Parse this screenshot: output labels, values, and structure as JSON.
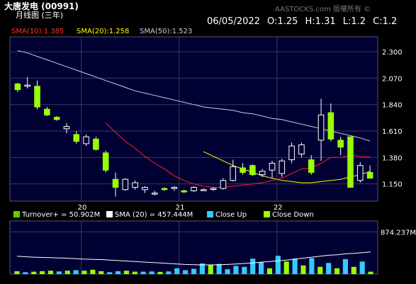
{
  "header": {
    "title": "大唐发电 (00991)",
    "subtitle": "月线图 (三年)",
    "watermark": "AASTOCKS.com 版權所有 ©",
    "ohlc": "06/05/2022  O:1.25  H:1.31  L:1.2  C:1.2"
  },
  "colors": {
    "background": "#000000",
    "plot_bg": "#000033",
    "grid": "#3a3a66",
    "candle": "#99ff00",
    "candle_outline": "#ffffff",
    "sma10": "#ff2020",
    "sma20": "#ffff00",
    "sma50": "#ccccdd",
    "turnover": "#66cc00",
    "turnover_sma": "#ffffff",
    "close_up": "#33ccff",
    "close_down": "#99ff00"
  },
  "sma_legend": {
    "sma10": "SMA(10):1.385",
    "sma20": "SMA(20):1.258",
    "sma50": "SMA(50):1.523"
  },
  "volume_legend": {
    "turnover": "Turnover+ = 50.902M",
    "sma": "SMA (20) = 457.444M",
    "close_up": "Close Up",
    "close_down": "Close Down",
    "axis_label": "874.237M"
  },
  "chart_data": [
    {
      "type": "candlestick",
      "y_ticks": [
        "2.300",
        "2.070",
        "1.840",
        "1.610",
        "1.380",
        "1.150"
      ],
      "ylim": [
        1.0,
        2.43
      ],
      "x_ticks": [
        "20",
        "21",
        "22"
      ],
      "x_tick_index": [
        6.5,
        16.5,
        26.5
      ],
      "candles": [
        {
          "o": 2.02,
          "h": 2.03,
          "l": 1.95,
          "c": 1.97
        },
        {
          "o": 2.0,
          "h": 2.08,
          "l": 1.98,
          "c": 2.01
        },
        {
          "o": 2.0,
          "h": 2.05,
          "l": 1.8,
          "c": 1.82
        },
        {
          "o": 1.8,
          "h": 1.82,
          "l": 1.74,
          "c": 1.75
        },
        {
          "o": 1.73,
          "h": 1.74,
          "l": 1.7,
          "c": 1.71
        },
        {
          "o": 1.63,
          "h": 1.68,
          "l": 1.59,
          "c": 1.65
        },
        {
          "o": 1.58,
          "h": 1.61,
          "l": 1.5,
          "c": 1.52
        },
        {
          "o": 1.5,
          "h": 1.58,
          "l": 1.48,
          "c": 1.56
        },
        {
          "o": 1.54,
          "h": 1.56,
          "l": 1.44,
          "c": 1.45
        },
        {
          "o": 1.42,
          "h": 1.44,
          "l": 1.25,
          "c": 1.27
        },
        {
          "o": 1.19,
          "h": 1.25,
          "l": 1.04,
          "c": 1.12
        },
        {
          "o": 1.1,
          "h": 1.2,
          "l": 1.09,
          "c": 1.19
        },
        {
          "o": 1.12,
          "h": 1.18,
          "l": 1.1,
          "c": 1.16
        },
        {
          "o": 1.1,
          "h": 1.13,
          "l": 1.07,
          "c": 1.12
        },
        {
          "o": 1.07,
          "h": 1.09,
          "l": 1.05,
          "c": 1.07
        },
        {
          "o": 1.11,
          "h": 1.12,
          "l": 1.09,
          "c": 1.1
        },
        {
          "o": 1.11,
          "h": 1.13,
          "l": 1.09,
          "c": 1.12
        },
        {
          "o": 1.09,
          "h": 1.1,
          "l": 1.07,
          "c": 1.08
        },
        {
          "o": 1.09,
          "h": 1.13,
          "l": 1.08,
          "c": 1.12
        },
        {
          "o": 1.1,
          "h": 1.11,
          "l": 1.09,
          "c": 1.1
        },
        {
          "o": 1.11,
          "h": 1.12,
          "l": 1.09,
          "c": 1.11
        },
        {
          "o": 1.11,
          "h": 1.2,
          "l": 1.1,
          "c": 1.18
        },
        {
          "o": 1.18,
          "h": 1.36,
          "l": 1.17,
          "c": 1.3
        },
        {
          "o": 1.29,
          "h": 1.33,
          "l": 1.23,
          "c": 1.25
        },
        {
          "o": 1.31,
          "h": 1.32,
          "l": 1.22,
          "c": 1.23
        },
        {
          "o": 1.23,
          "h": 1.28,
          "l": 1.21,
          "c": 1.26
        },
        {
          "o": 1.27,
          "h": 1.35,
          "l": 1.2,
          "c": 1.33
        },
        {
          "o": 1.24,
          "h": 1.37,
          "l": 1.21,
          "c": 1.35
        },
        {
          "o": 1.36,
          "h": 1.51,
          "l": 1.33,
          "c": 1.48
        },
        {
          "o": 1.41,
          "h": 1.51,
          "l": 1.38,
          "c": 1.49
        },
        {
          "o": 1.36,
          "h": 1.4,
          "l": 1.23,
          "c": 1.25
        },
        {
          "o": 1.53,
          "h": 1.89,
          "l": 1.35,
          "c": 1.75
        },
        {
          "o": 1.77,
          "h": 1.85,
          "l": 1.52,
          "c": 1.54
        },
        {
          "o": 1.53,
          "h": 1.56,
          "l": 1.4,
          "c": 1.47
        },
        {
          "o": 1.56,
          "h": 1.55,
          "l": 1.12,
          "c": 1.12
        },
        {
          "o": 1.18,
          "h": 1.34,
          "l": 1.16,
          "c": 1.31
        },
        {
          "o": 1.25,
          "h": 1.31,
          "l": 1.2,
          "c": 1.2
        }
      ],
      "sma10": [
        null,
        null,
        null,
        null,
        null,
        null,
        null,
        null,
        null,
        1.68,
        1.6,
        1.52,
        1.46,
        1.39,
        1.33,
        1.28,
        1.22,
        1.18,
        1.15,
        1.13,
        1.12,
        1.12,
        1.13,
        1.14,
        1.15,
        1.16,
        1.18,
        1.2,
        1.24,
        1.28,
        1.29,
        1.33,
        1.38,
        1.38,
        1.4,
        1.39,
        1.385
      ],
      "sma20": [
        null,
        null,
        null,
        null,
        null,
        null,
        null,
        null,
        null,
        null,
        null,
        null,
        null,
        null,
        null,
        null,
        null,
        null,
        null,
        1.43,
        1.39,
        1.35,
        1.31,
        1.28,
        1.25,
        1.22,
        1.2,
        1.18,
        1.17,
        1.16,
        1.16,
        1.17,
        1.18,
        1.19,
        1.21,
        1.23,
        1.258
      ],
      "sma50": [
        2.31,
        2.29,
        2.26,
        2.23,
        2.2,
        2.17,
        2.14,
        2.11,
        2.08,
        2.05,
        2.02,
        1.99,
        1.96,
        1.94,
        1.92,
        1.9,
        1.88,
        1.86,
        1.84,
        1.82,
        1.81,
        1.8,
        1.79,
        1.77,
        1.76,
        1.74,
        1.72,
        1.71,
        1.69,
        1.67,
        1.65,
        1.63,
        1.61,
        1.59,
        1.57,
        1.55,
        1.523
      ]
    },
    {
      "type": "bar",
      "ylim": [
        0,
        1100
      ],
      "y_ticks": [
        "874.237M"
      ],
      "turnover": [
        60,
        40,
        50,
        60,
        70,
        55,
        70,
        80,
        70,
        90,
        60,
        40,
        60,
        70,
        50,
        50,
        55,
        45,
        55,
        120,
        80,
        110,
        220,
        190,
        210,
        100,
        170,
        150,
        320,
        250,
        120,
        380,
        260,
        320,
        180,
        330,
        150,
        230,
        120,
        310,
        150,
        260,
        50
      ],
      "color_up": [
        0,
        1,
        0,
        0,
        0,
        1,
        0,
        1,
        0,
        0,
        0,
        1,
        1,
        0,
        0,
        1,
        1,
        0,
        1,
        1,
        1,
        1,
        1,
        0,
        1,
        1,
        1,
        1,
        1,
        1,
        0,
        1,
        0,
        1,
        0,
        1,
        0,
        1,
        0,
        1,
        0,
        1,
        0
      ],
      "turnover_sma": [
        370,
        360,
        350,
        345,
        340,
        335,
        330,
        320,
        310,
        305,
        300,
        290,
        280,
        270,
        260,
        250,
        240,
        230,
        220,
        210,
        200,
        195,
        190,
        190,
        195,
        200,
        210,
        220,
        230,
        245,
        260,
        275,
        290,
        310,
        330,
        350,
        370,
        390,
        400,
        420,
        430,
        445,
        457
      ]
    }
  ]
}
